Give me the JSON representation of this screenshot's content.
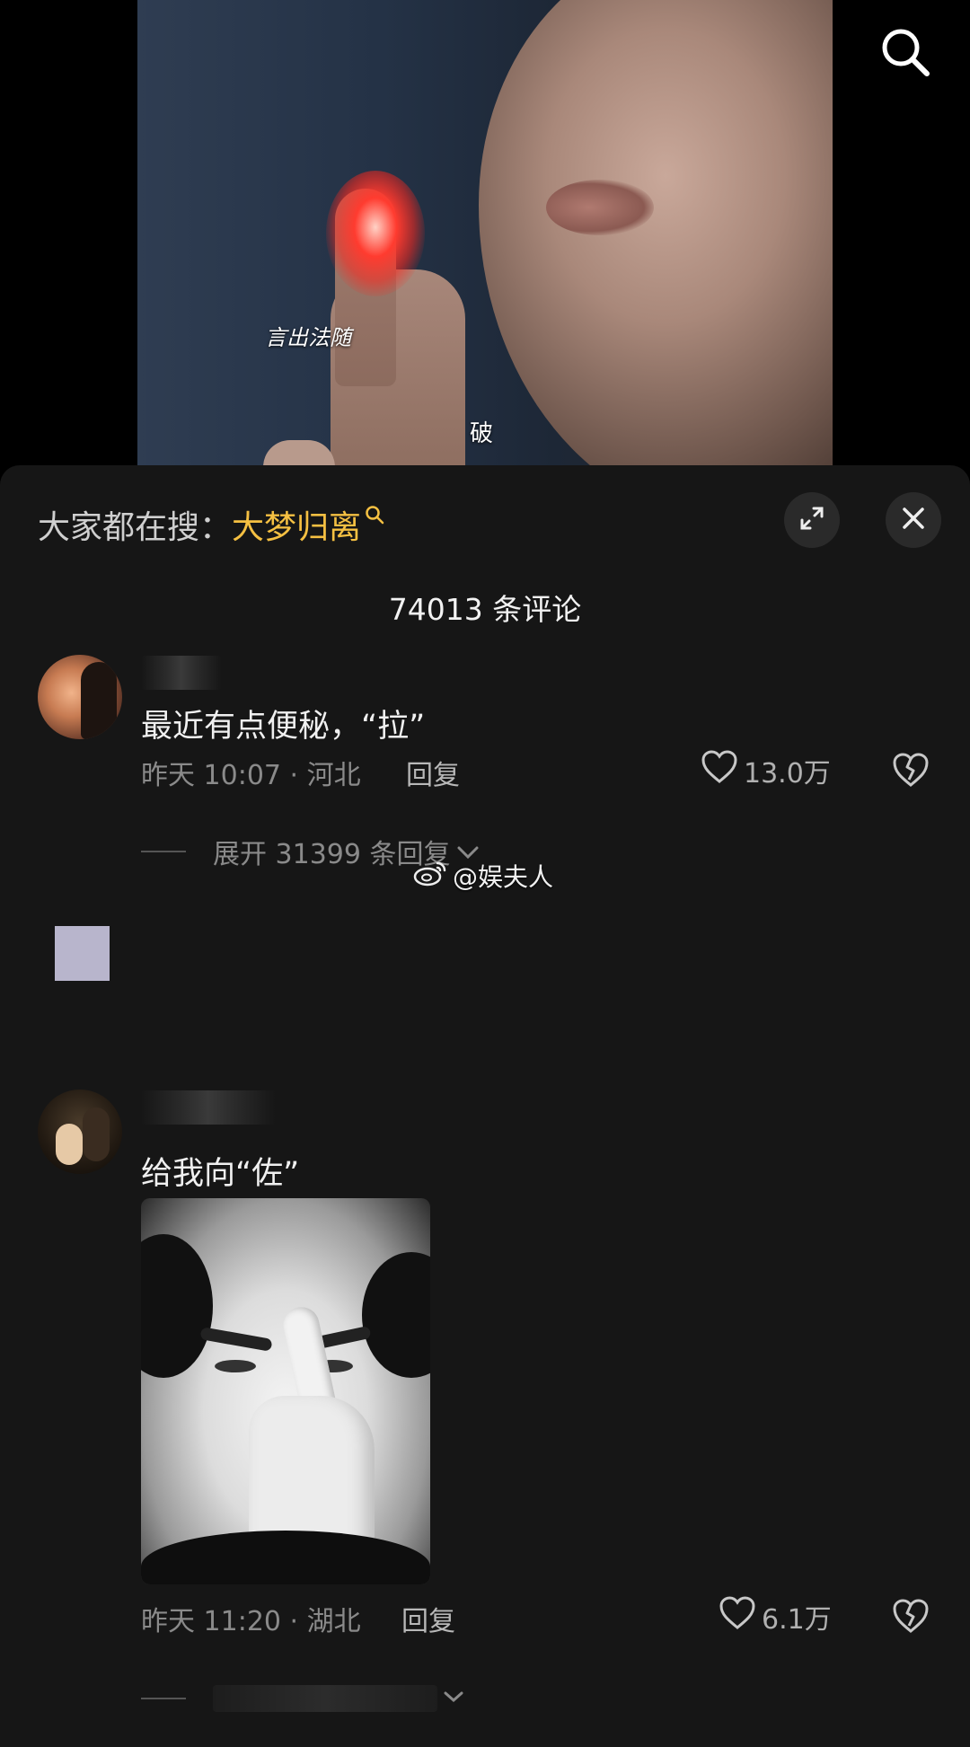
{
  "video": {
    "caption_1": "言出法随",
    "caption_2": "破"
  },
  "sheet": {
    "trend_prefix": "大家都在搜：",
    "trend_keyword": "大梦归离",
    "comment_count": "74013 条评论"
  },
  "comments": [
    {
      "text": "最近有点便秘，“拉”",
      "meta": "昨天 10:07 · 河北",
      "reply": "回复",
      "likes": "13.0万",
      "expand": "展开 31399 条回复"
    },
    {
      "text": "给我向“佐”",
      "meta": "昨天 11:20 · 湖北",
      "reply": "回复",
      "likes": "6.1万"
    }
  ],
  "watermark": "@娱夫人",
  "colors": {
    "sheet_bg": "#161616",
    "accent": "#f5c042"
  },
  "icons": [
    "search-icon",
    "expand-icon",
    "close-icon",
    "heart-icon",
    "broken-heart-icon",
    "chevron-down-icon",
    "weibo-icon"
  ]
}
